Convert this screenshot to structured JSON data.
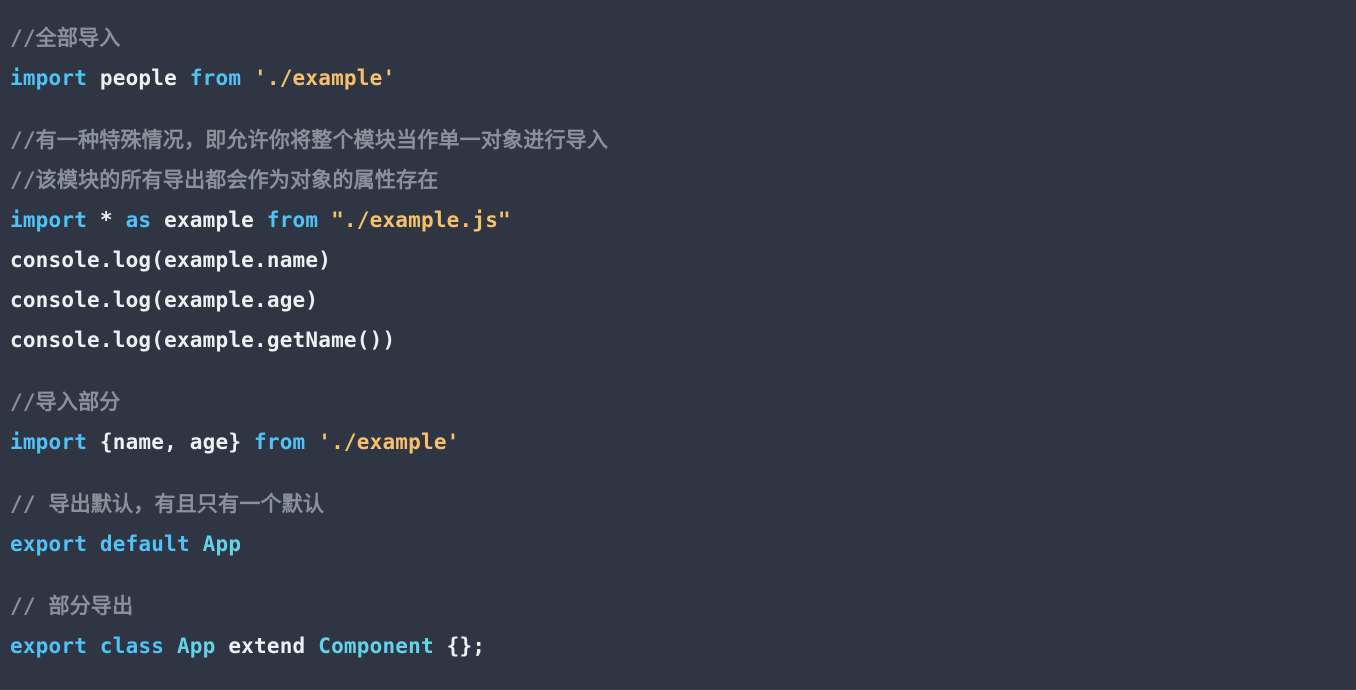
{
  "editor": {
    "background_color": "#2f3542",
    "language": "javascript",
    "font_weight": "bold"
  },
  "theme": {
    "comment_color": "#8a919c",
    "keyword_color": "#4fc3f7",
    "string_color": "#f5c26b",
    "plain_color": "#eef0f4",
    "type_color": "#62d3e8",
    "punctuation_color": "#eef0f4"
  },
  "code": {
    "lines": [
      {
        "index": 0,
        "kind": "comment",
        "text": "//全部导入",
        "tokens": [
          {
            "type": "comment",
            "text": "//全部导入"
          }
        ]
      },
      {
        "index": 1,
        "kind": "code",
        "text": "import people from './example'",
        "tokens": [
          {
            "type": "keyword",
            "text": "import"
          },
          {
            "type": "plain",
            "text": " people "
          },
          {
            "type": "keyword",
            "text": "from"
          },
          {
            "type": "plain",
            "text": " "
          },
          {
            "type": "string",
            "text": "'./example'"
          }
        ]
      },
      {
        "index": 2,
        "kind": "blank",
        "text": "",
        "tokens": []
      },
      {
        "index": 3,
        "kind": "comment",
        "text": "//有一种特殊情况，即允许你将整个模块当作单一对象进行导入",
        "tokens": [
          {
            "type": "comment",
            "text": "//有一种特殊情况，即允许你将整个模块当作单一对象进行导入"
          }
        ]
      },
      {
        "index": 4,
        "kind": "comment",
        "text": "//该模块的所有导出都会作为对象的属性存在",
        "tokens": [
          {
            "type": "comment",
            "text": "//该模块的所有导出都会作为对象的属性存在"
          }
        ]
      },
      {
        "index": 5,
        "kind": "code",
        "text": "import * as example from \"./example.js\"",
        "tokens": [
          {
            "type": "keyword",
            "text": "import"
          },
          {
            "type": "plain",
            "text": " * "
          },
          {
            "type": "keyword",
            "text": "as"
          },
          {
            "type": "plain",
            "text": " example "
          },
          {
            "type": "keyword",
            "text": "from"
          },
          {
            "type": "plain",
            "text": " "
          },
          {
            "type": "string",
            "text": "\"./example.js\""
          }
        ]
      },
      {
        "index": 6,
        "kind": "code",
        "text": "console.log(example.name)",
        "tokens": [
          {
            "type": "plain",
            "text": "console.log(example.name)"
          }
        ]
      },
      {
        "index": 7,
        "kind": "code",
        "text": "console.log(example.age)",
        "tokens": [
          {
            "type": "plain",
            "text": "console.log(example.age)"
          }
        ]
      },
      {
        "index": 8,
        "kind": "code",
        "text": "console.log(example.getName())",
        "tokens": [
          {
            "type": "plain",
            "text": "console.log(example.getName())"
          }
        ]
      },
      {
        "index": 9,
        "kind": "blank",
        "text": "",
        "tokens": []
      },
      {
        "index": 10,
        "kind": "comment",
        "text": "//导入部分",
        "tokens": [
          {
            "type": "comment",
            "text": "//导入部分"
          }
        ]
      },
      {
        "index": 11,
        "kind": "code",
        "text": "import {name, age} from './example'",
        "tokens": [
          {
            "type": "keyword",
            "text": "import"
          },
          {
            "type": "plain",
            "text": " {name, age} "
          },
          {
            "type": "keyword",
            "text": "from"
          },
          {
            "type": "plain",
            "text": " "
          },
          {
            "type": "string",
            "text": "'./example'"
          }
        ]
      },
      {
        "index": 12,
        "kind": "blank",
        "text": "",
        "tokens": []
      },
      {
        "index": 13,
        "kind": "comment",
        "text": "// 导出默认，有且只有一个默认",
        "tokens": [
          {
            "type": "comment",
            "text": "// 导出默认，有且只有一个默认"
          }
        ]
      },
      {
        "index": 14,
        "kind": "code",
        "text": "export default App",
        "tokens": [
          {
            "type": "keyword",
            "text": "export"
          },
          {
            "type": "plain",
            "text": " "
          },
          {
            "type": "keyword",
            "text": "default"
          },
          {
            "type": "plain",
            "text": " "
          },
          {
            "type": "type",
            "text": "App"
          }
        ]
      },
      {
        "index": 15,
        "kind": "blank",
        "text": "",
        "tokens": []
      },
      {
        "index": 16,
        "kind": "comment",
        "text": "// 部分导出",
        "tokens": [
          {
            "type": "comment",
            "text": "// 部分导出"
          }
        ]
      },
      {
        "index": 17,
        "kind": "code",
        "text": "export class App extend Component {};",
        "tokens": [
          {
            "type": "keyword",
            "text": "export"
          },
          {
            "type": "plain",
            "text": " "
          },
          {
            "type": "keyword",
            "text": "class"
          },
          {
            "type": "plain",
            "text": " "
          },
          {
            "type": "type",
            "text": "App"
          },
          {
            "type": "plain",
            "text": " extend "
          },
          {
            "type": "type",
            "text": "Component"
          },
          {
            "type": "punct",
            "text": " {};"
          }
        ]
      }
    ]
  }
}
